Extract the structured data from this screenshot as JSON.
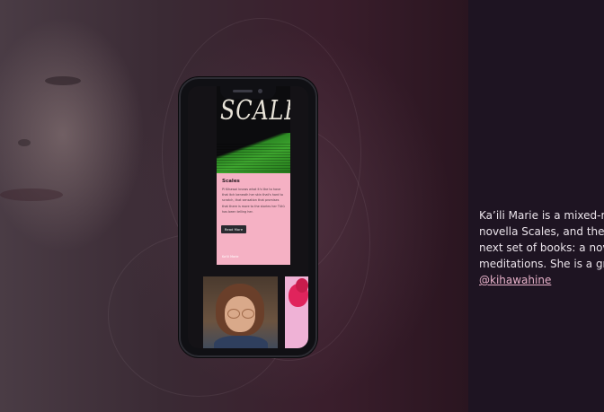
{
  "phone_preview": {
    "cover_title": "SCALES",
    "card": {
      "title": "Scales",
      "body": "Pi Kihawai knows what it's like to have that itch beneath her skin that's hard to scratch, that sensation that promises that there is more to the stories her Tūtū has been telling her.",
      "button_label": "Read More",
      "author": "Ka'ili Marie"
    }
  },
  "bio": {
    "lines": [
      "Ka’ili Marie is a mixed-me",
      "novella Scales, and the bo",
      "next set of books: a novel",
      "meditations. She is a grad"
    ],
    "handle": "@kihawahine"
  },
  "colors": {
    "card_pink": "#f5b1c4",
    "link_pink": "#e7b1c9",
    "right_panel": "#1e1422"
  }
}
